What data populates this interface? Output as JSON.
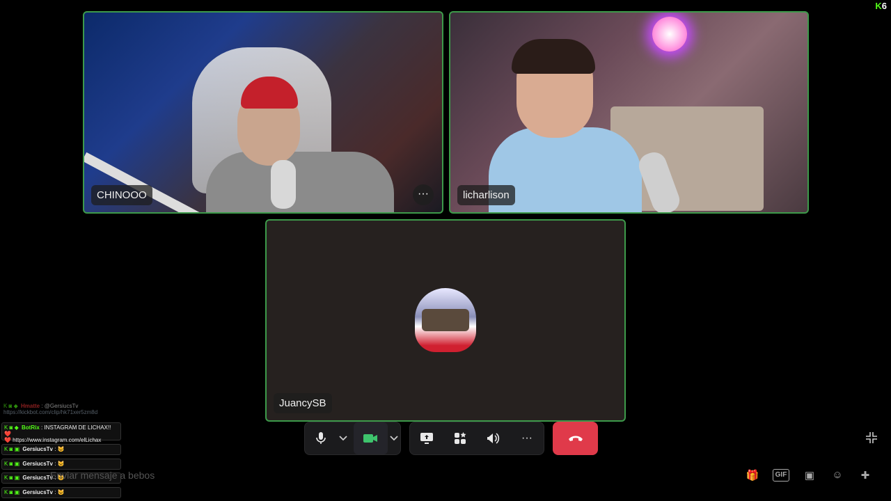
{
  "brand": {
    "logo_k": "K",
    "logo_n": "6"
  },
  "participants": [
    {
      "name": "CHINOOO"
    },
    {
      "name": "licharlison"
    },
    {
      "name": "JuancySB"
    }
  ],
  "tile_menu_glyph": "···",
  "controls": {
    "mic": "🎤",
    "mic_menu": "⌄",
    "camera": "■",
    "camera_menu": "⌄",
    "share": "⇪",
    "activities": "✦",
    "soundboard": "♪",
    "more": "···",
    "hangup": "☎"
  },
  "chat_input_placeholder": "Enviar mensaje a bebos",
  "chat_messages": [
    {
      "user": "Hmatte",
      "user_color": "#ff3b3b",
      "text": "@GersiucsTv",
      "extra": "https://kickbot.com/clip/hk71xer5zm8d"
    },
    {
      "user": "BotRix",
      "user_color": "#53fc18",
      "text": "INSTAGRAM DE LICHAX!! ❤️",
      "extra": "❤️ https://www.instagram.com/elLichax"
    },
    {
      "user": "GersiucsTv",
      "user_color": "#ffffff",
      "text": "😺"
    },
    {
      "user": "GersiucsTv",
      "user_color": "#ffffff",
      "text": "😺"
    },
    {
      "user": "GersiucsTv",
      "user_color": "#ffffff",
      "text": "😺"
    },
    {
      "user": "GersiucsTv",
      "user_color": "#ffffff",
      "text": "😺"
    }
  ],
  "chat_icons": [
    "🎁",
    "GIF",
    "▣",
    "☺",
    "✚"
  ],
  "minimize_glyph": "⤡"
}
